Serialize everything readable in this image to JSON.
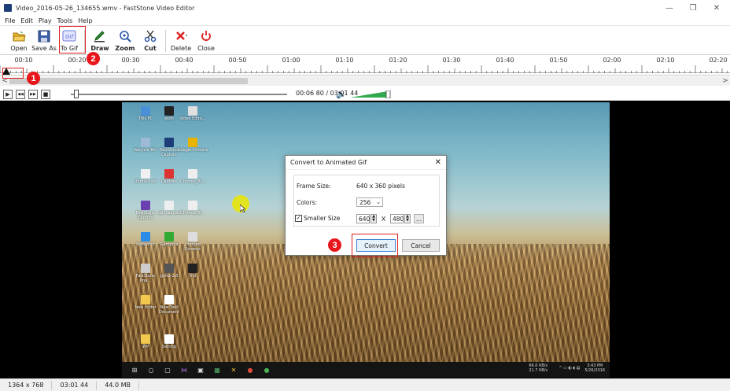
{
  "window": {
    "title": "Video_2016-05-26_134655.wmv - FastStone Video Editor",
    "controls": [
      "—",
      "❐",
      "✕"
    ]
  },
  "menu": [
    "File",
    "Edit",
    "Play",
    "Tools",
    "Help"
  ],
  "toolbar": {
    "open": "Open",
    "save_as": "Save As",
    "to_gif": "To Gif",
    "draw": "Draw",
    "zoom": "Zoom",
    "cut": "Cut",
    "delete": "Delete",
    "close": "Close",
    "gif_icon_text": "Gif"
  },
  "timeline": {
    "ticks": [
      "00:10",
      "00:20",
      "00:30",
      "00:40",
      "00:50",
      "01:00",
      "01:10",
      "01:20",
      "01:30",
      "01:40",
      "01:50",
      "02:00",
      "02:10",
      "02:20"
    ]
  },
  "scroll": {
    "left": "<",
    "right": ">"
  },
  "playback": {
    "play": "▶",
    "prev": "◀◀",
    "next": "▶▶",
    "stop": "■",
    "timecode": "00:06 80 / 03:01 44"
  },
  "desktop_icons": [
    {
      "label": "This PC",
      "color": "#4a90d9"
    },
    {
      "label": "work",
      "color": "#222222"
    },
    {
      "label": "Video Edito...",
      "color": "#e0e0e0"
    },
    {
      "label": "Recycle Bin",
      "color": "#9fb8d8"
    },
    {
      "label": "FastStone Capture",
      "color": "#1c3d78"
    },
    {
      "label": "Google Chrome",
      "color": "#e8b400"
    },
    {
      "label": "Untitled.txt",
      "color": "#f0f0f0"
    },
    {
      "label": "Capture",
      "color": "#d33"
    },
    {
      "label": "Chrome_Bl...",
      "color": "#eee"
    },
    {
      "label": "FastStone Capture",
      "color": "#6a3fb0"
    },
    {
      "label": "Lab capture",
      "color": "#eee"
    },
    {
      "label": "Chrome_Bl...",
      "color": "#eee"
    },
    {
      "label": "Networks",
      "color": "#2a8be8"
    },
    {
      "label": "Gardenia",
      "color": "#3a3"
    },
    {
      "label": "Untitled Screens",
      "color": "#ddd"
    },
    {
      "label": "FastStone Ima...",
      "color": "#ccc"
    },
    {
      "label": "gimp-2.8",
      "color": "#555"
    },
    {
      "label": "Vid",
      "color": "#222"
    },
    {
      "label": "New folder",
      "color": "#f2c94c"
    },
    {
      "label": "New Text Document",
      "color": "#ffffff"
    },
    {
      "label": "WP",
      "color": "#f2c94c"
    },
    {
      "label": "Setting",
      "color": "#ffffff"
    }
  ],
  "taskbar": {
    "icons": [
      "⊞",
      "○",
      "▢",
      "⋈",
      "▣",
      "▦",
      "✕",
      "●",
      "●"
    ],
    "network": "66.0 KB/s  21.7 KB/s",
    "time": "3:43 PM",
    "date": "5/26/2016"
  },
  "dialog": {
    "title": "Convert to Animated Gif",
    "close": "✕",
    "frame_size_label": "Frame Size:",
    "frame_size_value": "640 x 360 pixels",
    "colors_label": "Colors:",
    "colors_value": "256",
    "smaller_size_label": "Smaller Size",
    "smaller_checked": "✓",
    "width": "640",
    "x_sep": "X",
    "height": "480",
    "more": "...",
    "convert": "Convert",
    "cancel": "Cancel"
  },
  "annotations": {
    "one": "1",
    "two": "2",
    "three": "3"
  },
  "statusbar": {
    "resolution": "1364 x 768",
    "duration": "03:01 44",
    "size": "44.0 MB"
  },
  "colors": {
    "accent_red": "#e8161a",
    "primary_border": "#3a7bd5"
  }
}
